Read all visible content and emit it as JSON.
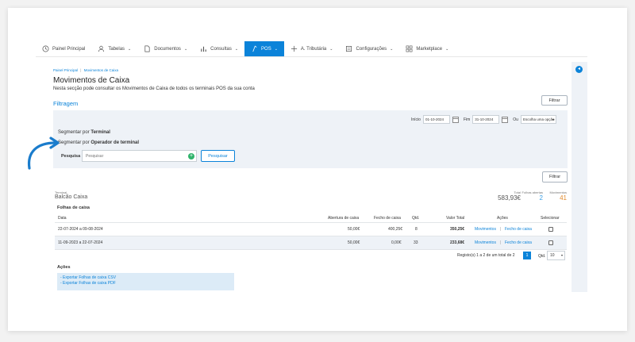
{
  "nav": {
    "items": [
      {
        "label": "Painel Principal",
        "icon": "clock-icon",
        "caret": false,
        "active": false
      },
      {
        "label": "Tabelas",
        "icon": "user-icon",
        "caret": true,
        "active": false
      },
      {
        "label": "Documentos",
        "icon": "document-icon",
        "caret": true,
        "active": false
      },
      {
        "label": "Consultas",
        "icon": "bars-icon",
        "caret": true,
        "active": false
      },
      {
        "label": "POS",
        "icon": "pos-icon",
        "caret": true,
        "active": true
      },
      {
        "label": "A. Tributária",
        "icon": "cross-icon",
        "caret": true,
        "active": false
      },
      {
        "label": "Configurações",
        "icon": "settings-icon",
        "caret": true,
        "active": false
      },
      {
        "label": "Marketplace",
        "icon": "grid-icon",
        "caret": true,
        "active": false
      }
    ],
    "caret_glyph": "⌄"
  },
  "breadcrumb": {
    "home": "Painel Principal",
    "separator": "|",
    "current": "Movimentos de Caixa"
  },
  "page": {
    "title": "Movimentos de Caixa",
    "subtitle": "Nesta secção pode consultar os Movimentos de Caixa de todos os terminais POS da sua conta",
    "filter_title": "Filtragem",
    "filter_button": "Filtrar"
  },
  "filters": {
    "start_label": "Início",
    "start_value": "01-10-2024",
    "end_label": "Fim",
    "end_value": "31-10-2024",
    "or_label": "Ou",
    "option_placeholder": "Escolha uma opção",
    "segment_terminal_prefix": "Segmentar por",
    "segment_terminal_bold": "Terminal",
    "segment_operator_prefix": "Segmentar por",
    "segment_operator_bold": "Operador de terminal",
    "search_label": "Pesquisa",
    "search_placeholder": "Pesquisar",
    "search_button": "Pesquisar"
  },
  "summary": {
    "terminal_label": "Terminal",
    "terminal_value": "Balcão Caixa",
    "total_label": "Total",
    "total_value": "583,93€",
    "open_label": "Folhas abertas",
    "open_value": "2",
    "movements_label": "Movimentos",
    "movements_value": "41",
    "open_color": "#3aa0e6",
    "movements_color": "#e08a2e"
  },
  "table": {
    "title": "Folhas de caixa",
    "headers": {
      "date": "Data",
      "opening": "Abertura de caixa",
      "closing": "Fecho de caixa",
      "qty": "Qtd.",
      "total": "Valor Total",
      "actions": "Ações",
      "select": "Selecionar"
    },
    "rows": [
      {
        "date": "22-07-2024 a 09-08-2024",
        "opening": "50,00€",
        "closing": "400,25€",
        "qty": "8",
        "total": "350,25€",
        "link1": "Movimentos",
        "sep": "|",
        "link2": "Fecho de caixa"
      },
      {
        "date": "11-09-2023 a 22-07-2024",
        "opening": "50,00€",
        "closing": "0,00€",
        "qty": "33",
        "total": "233,68€",
        "link1": "Movimentos",
        "sep": "|",
        "link2": "Fecho de caixa"
      }
    ]
  },
  "pagination": {
    "text": "Registo(s) 1 a 2 de um total de 2",
    "page": "1",
    "qty_label": "Qtd.",
    "qty_value": "10"
  },
  "actions": {
    "title": "Ações",
    "items": [
      "- Exportar Folhas de caixa CSV",
      "- Exportar Folhas de caixa PDF"
    ]
  },
  "colors": {
    "accent": "#0b83d9",
    "panel": "#eef2f7"
  }
}
